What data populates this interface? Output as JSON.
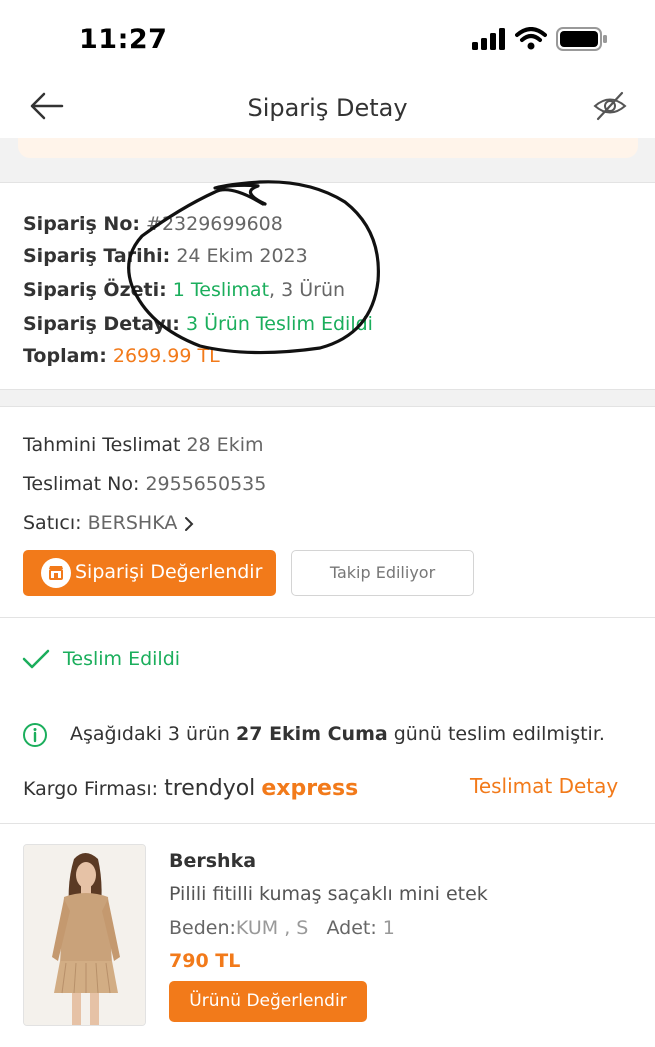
{
  "status_bar": {
    "time": "11:27"
  },
  "header": {
    "title": "Sipariş Detay"
  },
  "summary": {
    "order_no_label": "Sipariş No:",
    "order_no_value": "#2329699608",
    "order_date_label": "Sipariş Tarihi:",
    "order_date_value": "24 Ekim 2023",
    "order_summary_label": "Sipariş Özeti:",
    "order_summary_deliveries": "1 Teslimat",
    "order_summary_items": ", 3 Ürün",
    "order_detail_label": "Sipariş Detayı:",
    "order_detail_value": "3 Ürün Teslim Edildi",
    "total_label": "Toplam:",
    "total_value": "2699.99 TL"
  },
  "shipment": {
    "est_delivery_label": "Tahmini Teslimat",
    "est_delivery_value": "28 Ekim",
    "delivery_no_label": "Teslimat No:",
    "delivery_no_value": "2955650535",
    "seller_label": "Satıcı:",
    "seller_value": "BERSHKA",
    "rate_order_button": "Siparişi Değerlendir",
    "follow_button": "Takip Ediliyor"
  },
  "status": {
    "delivered_label": "Teslim Edildi",
    "info_prefix": "Aşağıdaki 3 ürün ",
    "info_bold": "27 Ekim Cuma",
    "info_suffix": " günü teslim edilmiştir.",
    "cargo_label": "Kargo Firması:",
    "cargo_brand_1": "trendyol",
    "cargo_brand_2": "express",
    "delivery_detail_link": "Teslimat Detay"
  },
  "product": {
    "brand": "Bershka",
    "name": "Pilili fitilli kumaş saçaklı mini etek",
    "size_label": "Beden:",
    "size_value": "KUM , S",
    "qty_label": "Adet:",
    "qty_value": "1",
    "price": "790 TL",
    "rate_button": "Ürünü Değerlendir"
  },
  "colors": {
    "accent": "#f27a1a",
    "success": "#1bae5c"
  }
}
